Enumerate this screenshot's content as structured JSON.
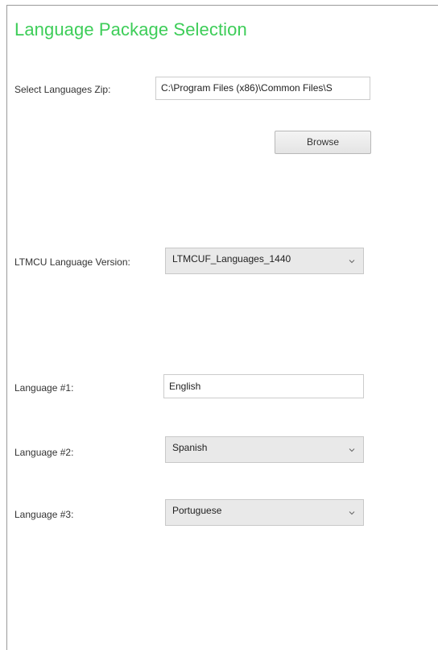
{
  "panel": {
    "title": "Language Package Selection",
    "title_color": "#3dcd58"
  },
  "zip": {
    "label": "Select Languages Zip:",
    "value": "C:\\Program Files (x86)\\Common Files\\S",
    "browse_label": "Browse"
  },
  "version": {
    "label": "LTMCU Language Version:",
    "selected": "LTMCUF_Languages_1440"
  },
  "languages": [
    {
      "label": "Language #1:",
      "value": "English",
      "type": "text"
    },
    {
      "label": "Language #2:",
      "value": "Spanish",
      "type": "select"
    },
    {
      "label": "Language #3:",
      "value": "Portuguese",
      "type": "select"
    }
  ],
  "icons": {
    "dropdown": "chevron-down-icon"
  }
}
